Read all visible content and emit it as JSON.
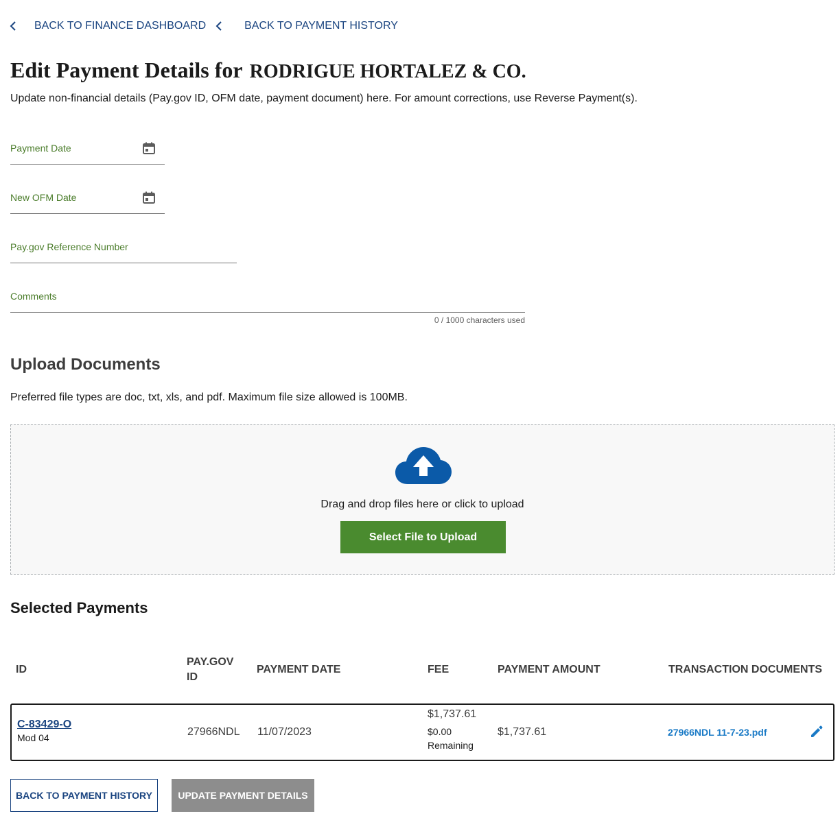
{
  "breadcrumbs": [
    {
      "label": "BACK TO FINANCE DASHBOARD",
      "icon": "chevron-left-icon"
    },
    {
      "label": "BACK TO PAYMENT HISTORY",
      "icon": "chevron-left-icon"
    }
  ],
  "header": {
    "title_lead": "Edit Payment Details for",
    "company": "RODRIGUE HORTALEZ & CO.",
    "subtitle": "Update non-financial details (Pay.gov ID, OFM date, payment document) here. For amount corrections, use Reverse Payment(s)."
  },
  "form": {
    "payment_date_label": "Payment Date",
    "ofm_date_label": "New OFM Date",
    "paygov_ref_label": "Pay.gov Reference Number",
    "comments_label": "Comments",
    "char_count": "0 / 1000 characters used",
    "calendar_icon": "calendar-icon"
  },
  "upload": {
    "title": "Upload Documents",
    "hint": "Preferred file types are doc, txt, xls, and pdf. Maximum file size allowed is 100MB.",
    "drop_text": "Drag and drop files here or click to upload",
    "select_button": "Select File to Upload",
    "icon": "cloud-upload-icon"
  },
  "selected_payments": {
    "title": "Selected Payments",
    "columns": {
      "id": "ID",
      "paygov_id_line1": "PAY.GOV",
      "paygov_id_line2": "ID",
      "payment_date": "PAYMENT DATE",
      "fee": "FEE",
      "payment_amount": "PAYMENT AMOUNT",
      "transaction_documents": "TRANSACTION DOCUMENTS"
    },
    "rows": [
      {
        "id": "C-83429-O",
        "mod": "Mod 04",
        "paygov_id": "27966NDL",
        "payment_date": "11/07/2023",
        "fee": "$1,737.61",
        "fee_remaining_amount": "$0.00",
        "fee_remaining_label": "Remaining",
        "payment_amount": "$1,737.61",
        "document": "27966NDL 11-7-23.pdf",
        "edit_icon": "pencil-icon"
      }
    ]
  },
  "actions": {
    "back_button": "BACK TO PAYMENT HISTORY",
    "update_button": "UPDATE PAYMENT DETAILS"
  },
  "colors": {
    "link_blue": "#1a4480",
    "label_green": "#4a7c2a",
    "button_green": "#4a8b2f",
    "disabled_gray": "#8d8d8d",
    "icon_blue": "#0b5aa8"
  }
}
